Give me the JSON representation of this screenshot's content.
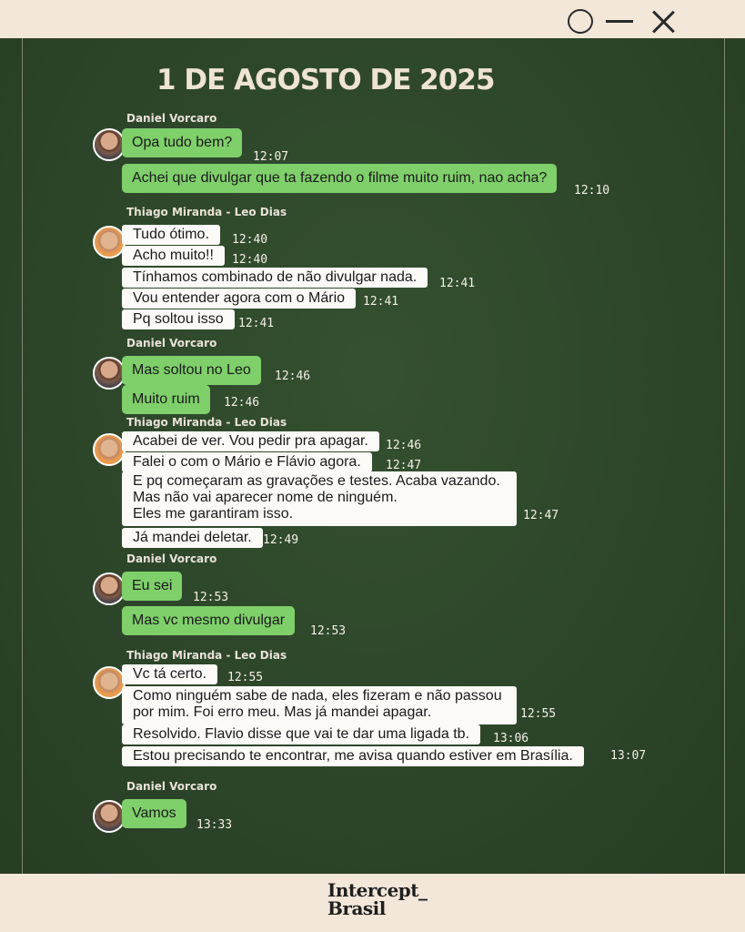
{
  "date_header": "1 DE AGOSTO DE 2025",
  "brand": {
    "line1": "Intercept_",
    "line2": "Brasil"
  },
  "groups": [
    {
      "sender": "Daniel Vorcaro",
      "messages": [
        {
          "text": "Opa tudo bem?",
          "time": "12:07"
        },
        {
          "text": "Achei que divulgar que ta fazendo o filme muito ruim, nao acha?",
          "time": "12:10"
        }
      ]
    },
    {
      "sender": "Thiago Miranda - Leo Dias",
      "messages": [
        {
          "text": "Tudo ótimo.",
          "time": "12:40"
        },
        {
          "text": "Acho muito!!",
          "time": "12:40"
        },
        {
          "text": "Tínhamos combinado de não divulgar nada.",
          "time": "12:41"
        },
        {
          "text": "Vou entender agora com o Mário",
          "time": "12:41"
        },
        {
          "text": "Pq soltou isso",
          "time": "12:41"
        }
      ]
    },
    {
      "sender": "Daniel Vorcaro",
      "messages": [
        {
          "text": "Mas soltou no Leo",
          "time": "12:46"
        },
        {
          "text": "Muito ruim",
          "time": "12:46"
        }
      ]
    },
    {
      "sender": "Thiago Miranda - Leo Dias",
      "messages": [
        {
          "text": "Acabei de ver. Vou pedir pra apagar.",
          "time": "12:46"
        },
        {
          "text": "Falei o com o Mário e Flávio agora.",
          "time": "12:47"
        },
        {
          "lines": [
            "E pq começaram as gravações e testes. Acaba vazando.",
            "Mas não vai aparecer nome de ninguém.",
            "Eles me garantiram isso."
          ],
          "time": "12:47"
        },
        {
          "text": "Já mandei deletar.",
          "time": "12:49"
        }
      ]
    },
    {
      "sender": "Daniel Vorcaro",
      "messages": [
        {
          "text": "Eu sei",
          "time": "12:53"
        },
        {
          "text": "Mas vc mesmo divulgar",
          "time": "12:53"
        }
      ]
    },
    {
      "sender": "Thiago Miranda - Leo Dias",
      "messages": [
        {
          "text": "Vc tá certo.",
          "time": "12:55"
        },
        {
          "lines": [
            "Como ninguém sabe de nada, eles fizeram e não passou",
            "por mim. Foi erro meu. Mas já mandei apagar."
          ],
          "time": "12:55"
        },
        {
          "text": "Resolvido. Flavio disse que vai te dar uma ligada tb.",
          "time": "13:06"
        },
        {
          "text": "Estou precisando te encontrar, me avisa quando estiver em Brasília.",
          "time": "13:07"
        }
      ]
    },
    {
      "sender": "Daniel Vorcaro",
      "messages": [
        {
          "text": "Vamos",
          "time": "13:33"
        }
      ]
    }
  ]
}
